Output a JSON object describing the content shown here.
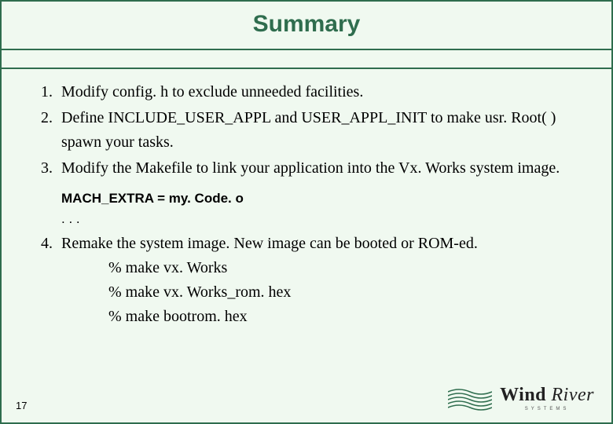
{
  "title": "Summary",
  "items": [
    {
      "num": "1.",
      "text": "Modify config. h to exclude unneeded facilities."
    },
    {
      "num": "2.",
      "text": "Define INCLUDE_USER_APPL and USER_APPL_INIT to make usr. Root( ) spawn your tasks."
    },
    {
      "num": "3.",
      "text": "Modify the Makefile to link your application into the Vx. Works system image."
    }
  ],
  "code_line": "MACH_EXTRA = my. Code. o",
  "ellipsis": ". . .",
  "item4": {
    "num": "4.",
    "text": "Remake the system image. New image can be booted or ROM-ed.",
    "commands": [
      "% make vx. Works",
      "% make vx. Works_rom. hex",
      "% make bootrom. hex"
    ]
  },
  "page_number": "17",
  "logo": {
    "text": "Wind River",
    "subtext": "SYSTEMS"
  }
}
